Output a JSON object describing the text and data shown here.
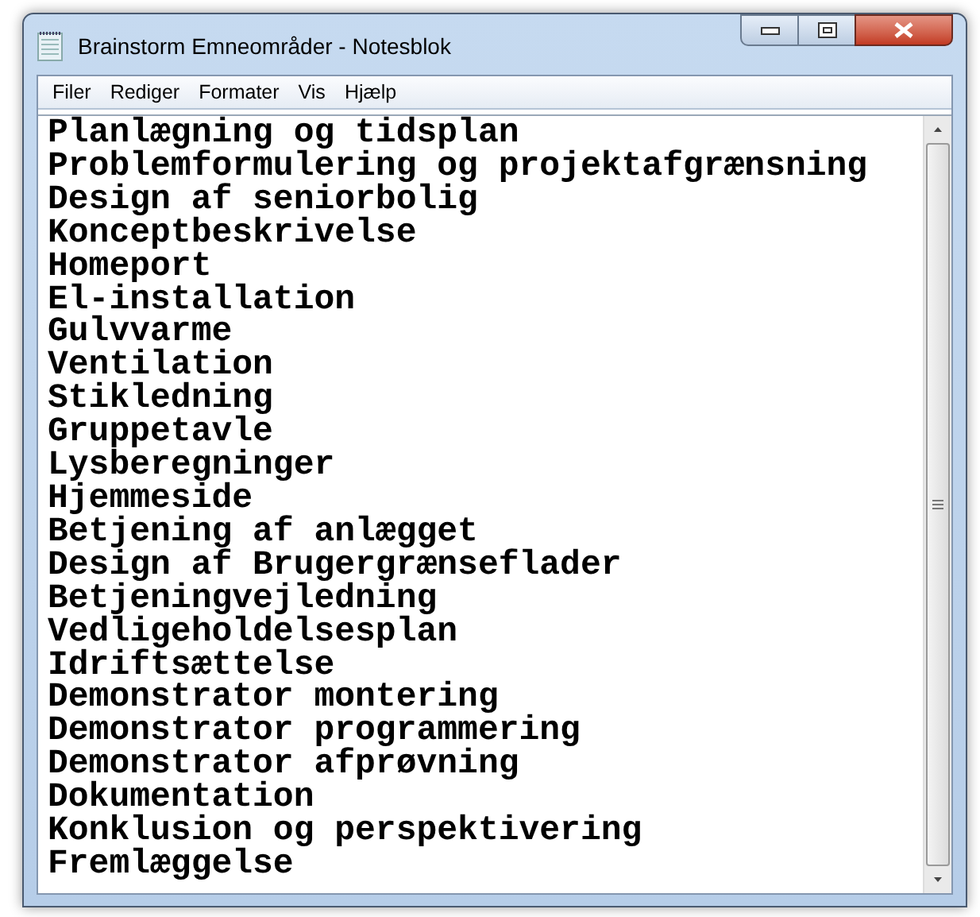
{
  "window": {
    "title": "Brainstorm Emneområder - Notesblok"
  },
  "menu": [
    {
      "label": "Filer"
    },
    {
      "label": "Rediger"
    },
    {
      "label": "Formater"
    },
    {
      "label": "Vis"
    },
    {
      "label": "Hjælp"
    }
  ],
  "document": {
    "lines": [
      "Planlægning og tidsplan",
      "Problemformulering og projektafgrænsning",
      "Design af seniorbolig",
      "Konceptbeskrivelse",
      "Homeport",
      "El-installation",
      "Gulvvarme",
      "Ventilation",
      "Stikledning",
      "Gruppetavle",
      "Lysberegninger",
      "Hjemmeside",
      "Betjening af anlægget",
      "Design af Brugergrænseflader",
      "Betjeningvejledning",
      "Vedligeholdelsesplan",
      "Idriftsættelse",
      "Demonstrator montering",
      "Demonstrator programmering",
      "Demonstrator afprøvning",
      "Dokumentation",
      "Konklusion og perspektivering",
      "Fremlæggelse"
    ]
  }
}
